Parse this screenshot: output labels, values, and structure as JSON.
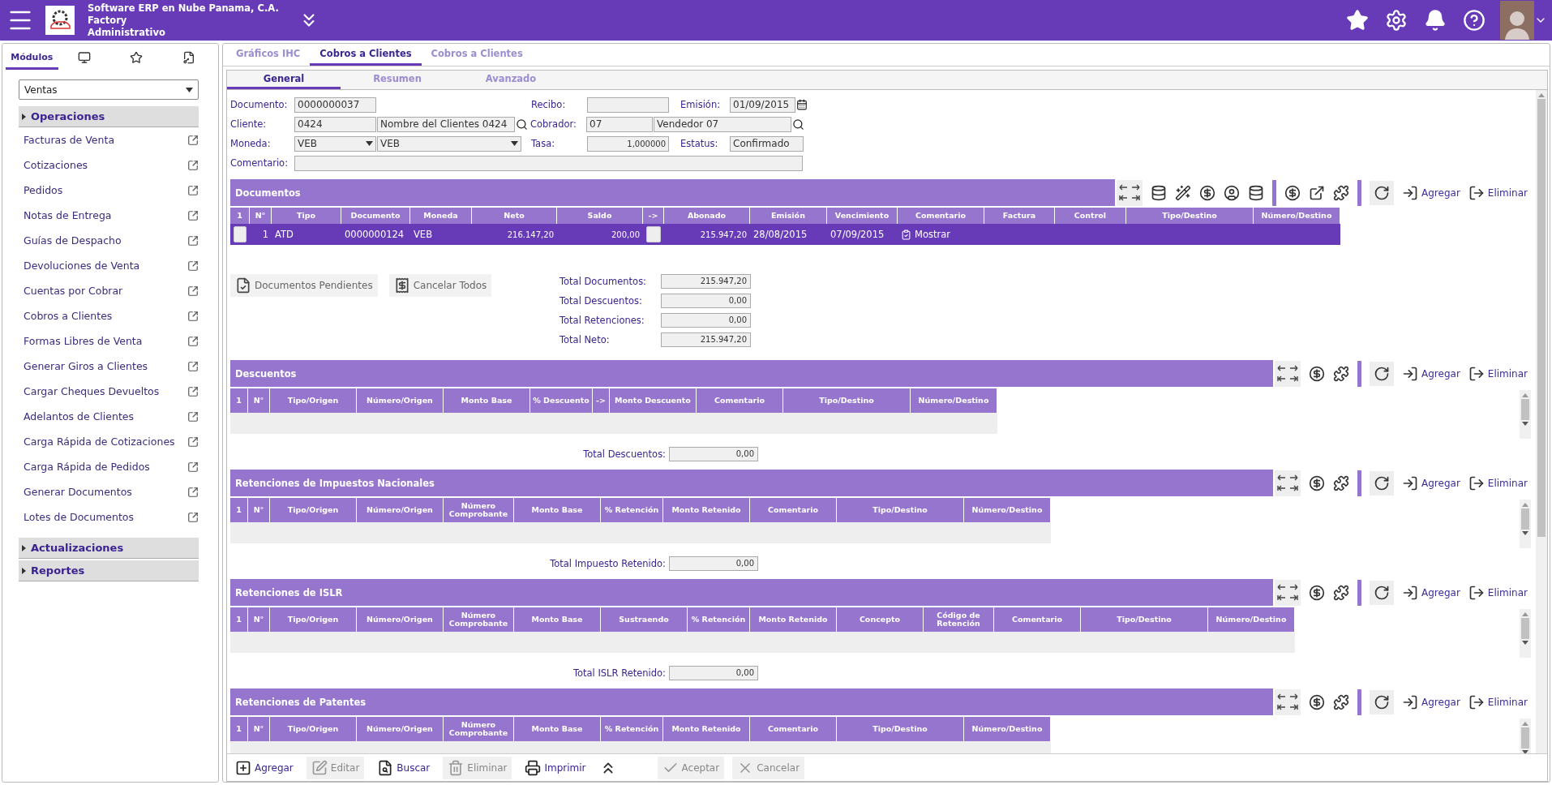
{
  "header": {
    "company": "Software ERP en Nube Panama, C.A.",
    "product": "Factory",
    "module": "Administrativo"
  },
  "sidebar": {
    "tabs": [
      {
        "label": "Módulos",
        "selected": true
      },
      {
        "selected": false
      },
      {
        "selected": false
      },
      {
        "selected": false
      }
    ],
    "module_select": "Ventas",
    "groups": [
      {
        "label": "Operaciones",
        "items": [
          "Facturas de Venta",
          "Cotizaciones",
          "Pedidos",
          "Notas de Entrega",
          "Guías de Despacho",
          "Devoluciones de Venta",
          "Cuentas por Cobrar",
          "Cobros a Clientes",
          "Formas Libres de Venta",
          "Generar Giros a Clientes",
          "Cargar Cheques Devueltos",
          "Adelantos de Clientes",
          "Carga Rápida de Cotizaciones",
          "Carga Rápida de Pedidos",
          "Generar Documentos",
          "Lotes de Documentos"
        ]
      },
      {
        "label": "Actualizaciones"
      },
      {
        "label": "Reportes"
      }
    ]
  },
  "tabs": [
    {
      "label": "Gráficos IHC",
      "selected": false
    },
    {
      "label": "Cobros a Clientes",
      "selected": true
    },
    {
      "label": "Cobros a Clientes",
      "selected": false
    }
  ],
  "subtabs": [
    {
      "label": "General",
      "selected": true
    },
    {
      "label": "Resumen",
      "selected": false
    },
    {
      "label": "Avanzado",
      "selected": false
    }
  ],
  "form": {
    "documento": {
      "label": "Documento:",
      "value": "0000000037"
    },
    "recibo": {
      "label": "Recibo:"
    },
    "emision": {
      "label": "Emisión:",
      "value": "01/09/2015"
    },
    "cliente": {
      "label": "Cliente:",
      "code": "0424",
      "name": "Nombre del Clientes 0424"
    },
    "cobrador": {
      "label": "Cobrador:",
      "code": "07",
      "name": "Vendedor 07"
    },
    "moneda": {
      "label": "Moneda:",
      "code": "VEB",
      "name": "VEB"
    },
    "tasa": {
      "label": "Tasa:",
      "value": "1,000000"
    },
    "estatus": {
      "label": "Estatus:",
      "value": "Confirmado"
    },
    "comentario": {
      "label": "Comentario:"
    }
  },
  "documents": {
    "title": "Documentos",
    "add": "Agregar",
    "remove": "Eliminar",
    "columns": [
      "1",
      "N°",
      "Tipo",
      "Documento",
      "Moneda",
      "Neto",
      "Saldo",
      "->",
      "Abonado",
      "Emisión",
      "Vencimiento",
      "Comentario",
      "Factura",
      "Control",
      "Tipo/Destino",
      "Número/Destino"
    ],
    "rows": [
      {
        "selected": true,
        "checked": false,
        "number": "1",
        "tipo": "ATD",
        "documento": "0000000124",
        "moneda": "VEB",
        "neto": "216.147,20",
        "saldo": "200,00",
        "transfer": false,
        "abonado": "215.947,20",
        "emision": "28/08/2015",
        "vencimiento": "07/09/2015",
        "comentario": "Mostrar"
      }
    ]
  },
  "actions": [
    {
      "label": "Documentos Pendientes",
      "disabled": true
    },
    {
      "label": "Cancelar Todos",
      "disabled": true
    }
  ],
  "totals": [
    {
      "label": "Total Documentos:",
      "value": "215.947,20"
    },
    {
      "label": "Total Descuentos:",
      "value": "0,00"
    },
    {
      "label": "Total Retenciones:",
      "value": "0,00"
    },
    {
      "label": "Total Neto:",
      "value": "215.947,20"
    }
  ],
  "sections": [
    {
      "title": "Descuentos",
      "add": "Agregar",
      "remove": "Eliminar",
      "columns": [
        "1",
        "N°",
        "Tipo/Origen",
        "Número/Origen",
        "Monto Base",
        "% Descuento",
        "->",
        "Monto Descuento",
        "Comentario",
        "Tipo/Destino",
        "Número/Destino"
      ],
      "total": {
        "label": "Total Descuentos:",
        "value": "0,00"
      }
    },
    {
      "title": "Retenciones de Impuestos Nacionales",
      "add": "Agregar",
      "remove": "Eliminar",
      "columns": [
        "1",
        "N°",
        "Tipo/Origen",
        "Número/Origen",
        "Número Comprobante",
        "Monto Base",
        "% Retención",
        "Monto Retenido",
        "Comentario",
        "Tipo/Destino",
        "Número/Destino"
      ],
      "total": {
        "label": "Total Impuesto Retenido:",
        "value": "0,00"
      }
    },
    {
      "title": "Retenciones de ISLR",
      "add": "Agregar",
      "remove": "Eliminar",
      "columns": [
        "1",
        "N°",
        "Tipo/Origen",
        "Número/Origen",
        "Número Comprobante",
        "Monto Base",
        "Sustraendo",
        "% Retención",
        "Monto Retenido",
        "Concepto",
        "Código de Retención",
        "Comentario",
        "Tipo/Destino",
        "Número/Destino"
      ],
      "total": {
        "label": "Total ISLR Retenido:",
        "value": "0,00"
      }
    },
    {
      "title": "Retenciones de Patentes",
      "add": "Agregar",
      "remove": "Eliminar",
      "columns": [
        "1",
        "N°",
        "Tipo/Origen",
        "Número/Origen",
        "Número Comprobante",
        "Monto Base",
        "% Retención",
        "Monto Retenido",
        "Comentario",
        "Tipo/Destino",
        "Número/Destino"
      ]
    }
  ],
  "toolbar": [
    {
      "label": "Agregar",
      "disabled": false
    },
    {
      "label": "Editar",
      "disabled": true
    },
    {
      "label": "Buscar",
      "disabled": false
    },
    {
      "label": "Eliminar",
      "disabled": true
    },
    {
      "label": "Imprimir",
      "disabled": false
    },
    {
      "label": "Aceptar",
      "disabled": true
    },
    {
      "label": "Cancelar",
      "disabled": true
    }
  ]
}
